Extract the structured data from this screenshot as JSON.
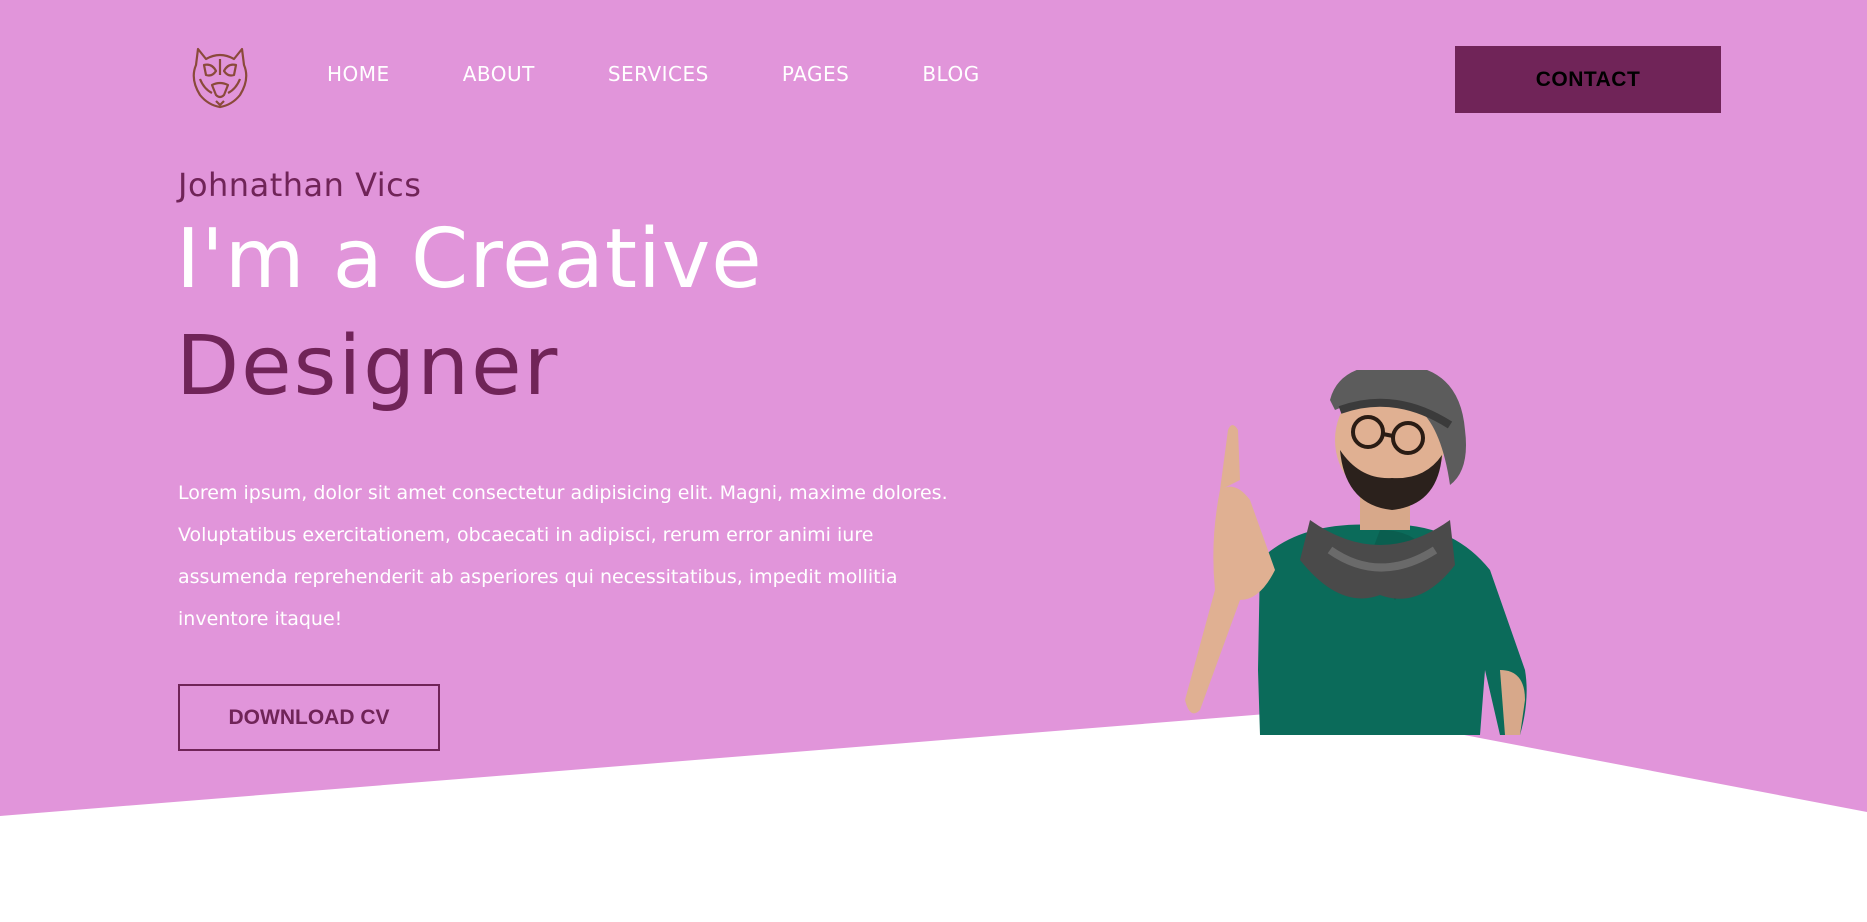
{
  "colors": {
    "background": "#E195DA",
    "accent": "#702458",
    "white": "#FFFFFF"
  },
  "logo": {
    "icon": "tiger-head-logo-icon"
  },
  "nav": {
    "items": [
      {
        "label": "HOME"
      },
      {
        "label": "ABOUT"
      },
      {
        "label": "SERVICES"
      },
      {
        "label": "PAGES"
      },
      {
        "label": "BLOG"
      }
    ],
    "contact_label": "CONTACT"
  },
  "hero": {
    "name": "Johnathan Vics",
    "headline_line1": "I'm a Creative",
    "headline_line2": "Designer",
    "bio": "Lorem ipsum, dolor sit amet consectetur adipisicing elit. Magni, maxime dolores. Voluptatibus exercitationem, obcaecati in adipisci, rerum error animi iure assumenda reprehenderit ab asperiores qui necessitatibus, impedit mollitia inventore itaque!",
    "download_label": "DOWNLOAD CV",
    "image_icon": "designer-pointing-up-photo"
  }
}
